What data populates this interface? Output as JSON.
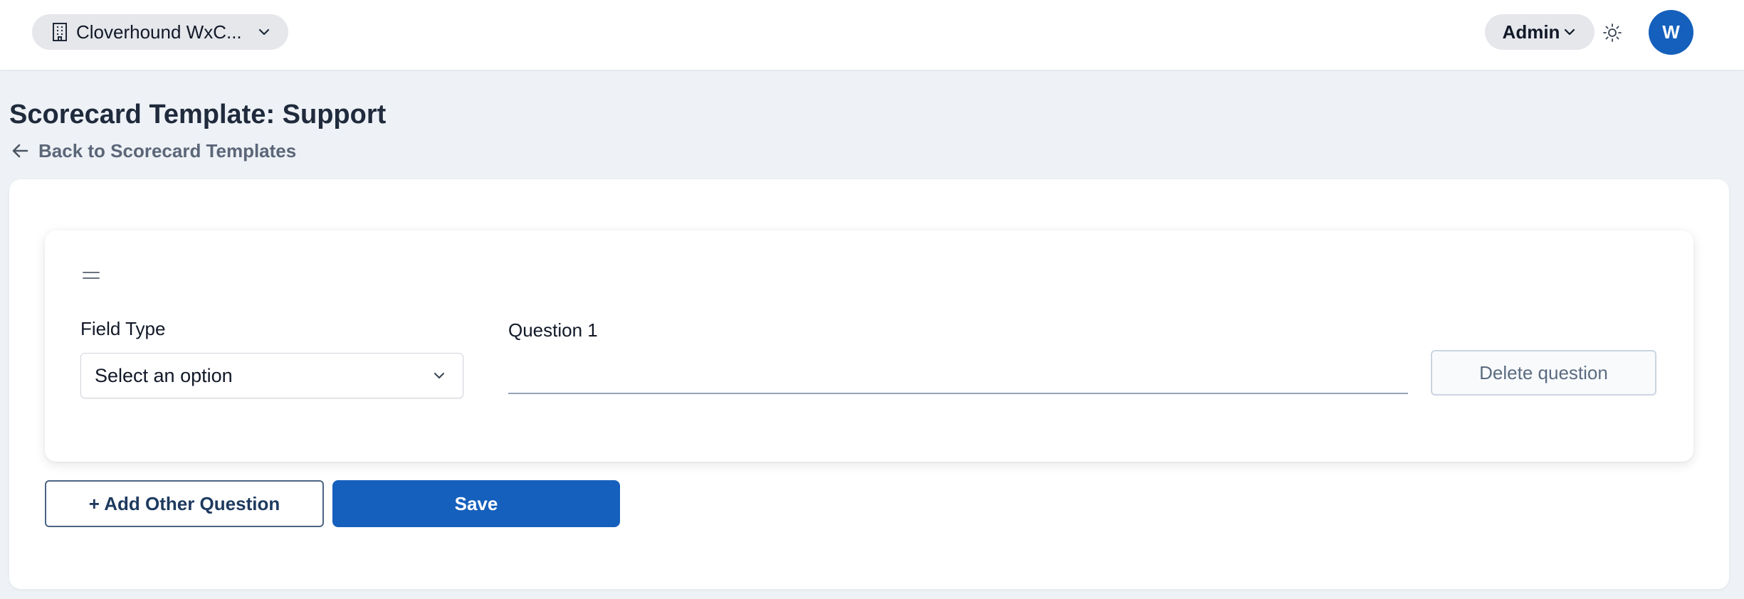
{
  "topbar": {
    "org_name": "Cloverhound WxC...",
    "org_icon": "building-icon",
    "role_label": "Admin",
    "theme_icon": "sun-icon",
    "avatar_initial": "W"
  },
  "header": {
    "title": "Scorecard Template: Support",
    "back_label": "Back to Scorecard Templates",
    "back_icon": "arrow-left-icon"
  },
  "question": {
    "drag_icon": "drag-handle-icon",
    "field_type_label": "Field Type",
    "field_type_value": "Select an option",
    "question_label": "Question 1",
    "question_value": "",
    "delete_label": "Delete question"
  },
  "actions": {
    "add_label": "+ Add Other Question",
    "save_label": "Save"
  },
  "colors": {
    "primary": "#1560bd",
    "page_background": "#eef2f6",
    "card_background": "#ffffff"
  }
}
